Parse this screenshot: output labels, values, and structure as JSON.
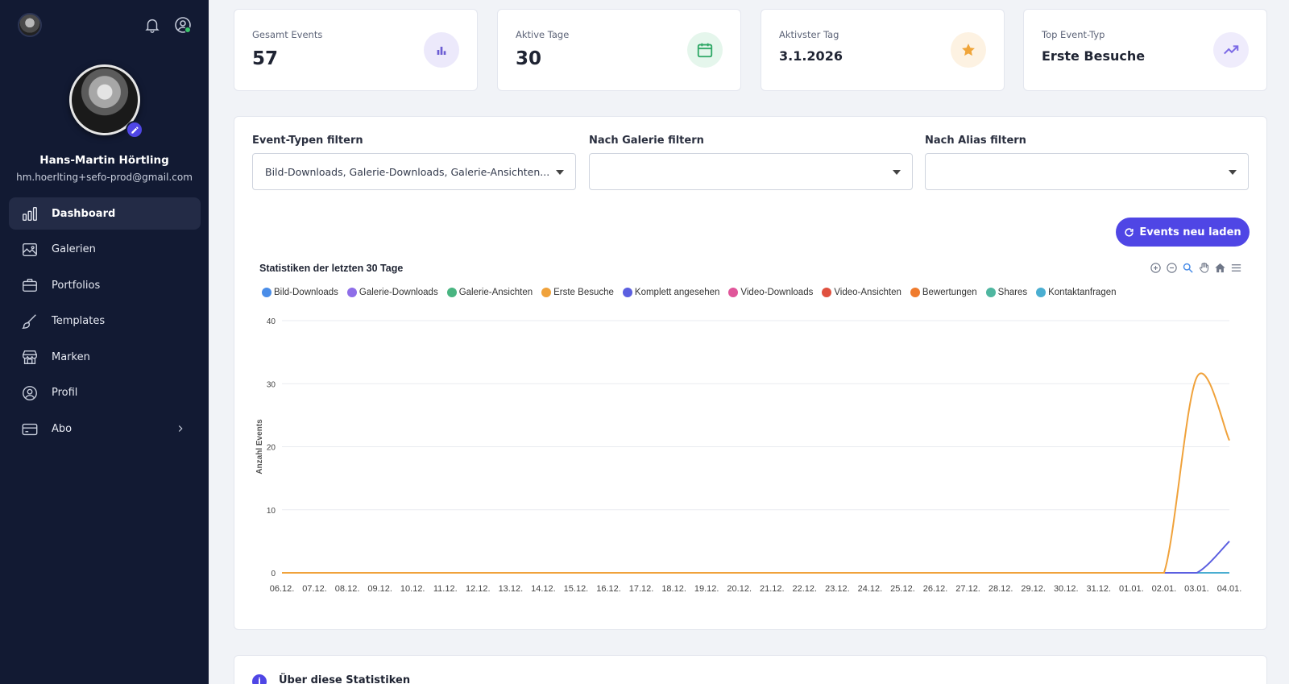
{
  "sidebar": {
    "user_name": "Hans-Martin Hörtling",
    "user_email": "hm.hoerlting+sefo-prod@gmail.com",
    "items": [
      {
        "label": "Dashboard",
        "icon": "bar-chart-icon",
        "active": true
      },
      {
        "label": "Galerien",
        "icon": "image-icon"
      },
      {
        "label": "Portfolios",
        "icon": "briefcase-icon"
      },
      {
        "label": "Templates",
        "icon": "brush-icon"
      },
      {
        "label": "Marken",
        "icon": "store-icon"
      },
      {
        "label": "Profil",
        "icon": "user-circle-icon"
      },
      {
        "label": "Abo",
        "icon": "credit-card-icon",
        "has_submenu": true
      }
    ]
  },
  "stats": [
    {
      "label": "Gesamt Events",
      "value": "57",
      "icon": "bar-chart-icon",
      "color": "#6c5dd3",
      "bg": "#ece9fb"
    },
    {
      "label": "Aktive Tage",
      "value": "30",
      "icon": "calendar-icon",
      "color": "#2fa866",
      "bg": "#e5f6ec"
    },
    {
      "label": "Aktivster Tag",
      "value": "3.1.2026",
      "icon": "star-icon",
      "color": "#f0a53a",
      "bg": "#fdf2e2"
    },
    {
      "label": "Top Event-Typ",
      "value": "Erste Besuche",
      "icon": "trending-up-icon",
      "color": "#7c6ae6",
      "bg": "#efecfc"
    }
  ],
  "filters": {
    "event_types_label": "Event-Typen filtern",
    "event_types_value": "Bild-Downloads, Galerie-Downloads, Galerie-Ansichten...",
    "gallery_label": "Nach Galerie filtern",
    "gallery_value": "",
    "alias_label": "Nach Alias filtern",
    "alias_value": ""
  },
  "reload_button": "Events neu laden",
  "chart_toolbar": [
    "zoom-in-icon",
    "zoom-out-icon",
    "selection-zoom-icon",
    "pan-hand-icon",
    "reset-home-icon",
    "menu-icon"
  ],
  "info": {
    "title": "Über diese Statistiken",
    "icon_glyph": "i"
  },
  "chart_data": {
    "type": "line",
    "title": "Statistiken der letzten 30 Tage",
    "ylabel": "Anzahl Events",
    "xlabel": "",
    "ylim": [
      0,
      40
    ],
    "yticks": [
      0,
      10,
      20,
      30,
      40
    ],
    "grid": true,
    "legend_position": "top-left",
    "categories": [
      "06.12.",
      "07.12.",
      "08.12.",
      "09.12.",
      "10.12.",
      "11.12.",
      "12.12.",
      "13.12.",
      "14.12.",
      "15.12.",
      "16.12.",
      "17.12.",
      "18.12.",
      "19.12.",
      "20.12.",
      "21.12.",
      "22.12.",
      "23.12.",
      "24.12.",
      "25.12.",
      "26.12.",
      "27.12.",
      "28.12.",
      "29.12.",
      "30.12.",
      "31.12.",
      "01.01.",
      "02.01.",
      "03.01.",
      "04.01."
    ],
    "series": [
      {
        "name": "Bild-Downloads",
        "color": "#4a8de8",
        "values": [
          0,
          0,
          0,
          0,
          0,
          0,
          0,
          0,
          0,
          0,
          0,
          0,
          0,
          0,
          0,
          0,
          0,
          0,
          0,
          0,
          0,
          0,
          0,
          0,
          0,
          0,
          0,
          0,
          0,
          0
        ]
      },
      {
        "name": "Galerie-Downloads",
        "color": "#8e6ee8",
        "values": [
          0,
          0,
          0,
          0,
          0,
          0,
          0,
          0,
          0,
          0,
          0,
          0,
          0,
          0,
          0,
          0,
          0,
          0,
          0,
          0,
          0,
          0,
          0,
          0,
          0,
          0,
          0,
          0,
          0,
          0
        ]
      },
      {
        "name": "Galerie-Ansichten",
        "color": "#49b581",
        "values": [
          0,
          0,
          0,
          0,
          0,
          0,
          0,
          0,
          0,
          0,
          0,
          0,
          0,
          0,
          0,
          0,
          0,
          0,
          0,
          0,
          0,
          0,
          0,
          0,
          0,
          0,
          0,
          0,
          0,
          0
        ]
      },
      {
        "name": "Erste Besuche",
        "color": "#f0a23b",
        "values": [
          0,
          0,
          0,
          0,
          0,
          0,
          0,
          0,
          0,
          0,
          0,
          0,
          0,
          0,
          0,
          0,
          0,
          0,
          0,
          0,
          0,
          0,
          0,
          0,
          0,
          0,
          0,
          0,
          31,
          21
        ]
      },
      {
        "name": "Komplett angesehen",
        "color": "#5b5fe0",
        "values": [
          0,
          0,
          0,
          0,
          0,
          0,
          0,
          0,
          0,
          0,
          0,
          0,
          0,
          0,
          0,
          0,
          0,
          0,
          0,
          0,
          0,
          0,
          0,
          0,
          0,
          0,
          0,
          0,
          0,
          5
        ]
      },
      {
        "name": "Video-Downloads",
        "color": "#e0569a",
        "values": [
          0,
          0,
          0,
          0,
          0,
          0,
          0,
          0,
          0,
          0,
          0,
          0,
          0,
          0,
          0,
          0,
          0,
          0,
          0,
          0,
          0,
          0,
          0,
          0,
          0,
          0,
          0,
          0,
          0,
          0
        ]
      },
      {
        "name": "Video-Ansichten",
        "color": "#e0513f",
        "values": [
          0,
          0,
          0,
          0,
          0,
          0,
          0,
          0,
          0,
          0,
          0,
          0,
          0,
          0,
          0,
          0,
          0,
          0,
          0,
          0,
          0,
          0,
          0,
          0,
          0,
          0,
          0,
          0,
          0,
          0
        ]
      },
      {
        "name": "Bewertungen",
        "color": "#ef7b2d",
        "values": [
          0,
          0,
          0,
          0,
          0,
          0,
          0,
          0,
          0,
          0,
          0,
          0,
          0,
          0,
          0,
          0,
          0,
          0,
          0,
          0,
          0,
          0,
          0,
          0,
          0,
          0,
          0,
          0,
          0,
          0
        ]
      },
      {
        "name": "Shares",
        "color": "#4fb6a0",
        "values": [
          0,
          0,
          0,
          0,
          0,
          0,
          0,
          0,
          0,
          0,
          0,
          0,
          0,
          0,
          0,
          0,
          0,
          0,
          0,
          0,
          0,
          0,
          0,
          0,
          0,
          0,
          0,
          0,
          0,
          0
        ]
      },
      {
        "name": "Kontaktanfragen",
        "color": "#4aaed1",
        "values": [
          0,
          0,
          0,
          0,
          0,
          0,
          0,
          0,
          0,
          0,
          0,
          0,
          0,
          0,
          0,
          0,
          0,
          0,
          0,
          0,
          0,
          0,
          0,
          0,
          0,
          0,
          0,
          0,
          0,
          0
        ]
      }
    ]
  }
}
